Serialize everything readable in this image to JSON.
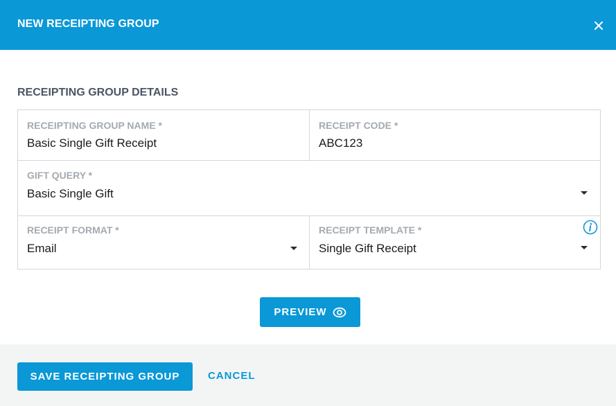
{
  "dialog": {
    "title": "NEW RECEIPTING GROUP",
    "close_icon": "close-icon"
  },
  "section": {
    "title": "RECEIPTING GROUP DETAILS"
  },
  "fields": {
    "group_name": {
      "label": "RECEIPTING GROUP NAME *",
      "value": "Basic Single Gift Receipt"
    },
    "receipt_code": {
      "label": "RECEIPT CODE *",
      "value": "ABC123"
    },
    "gift_query": {
      "label": "GIFT QUERY *",
      "value": "Basic Single Gift"
    },
    "receipt_format": {
      "label": "RECEIPT FORMAT *",
      "value": "Email"
    },
    "receipt_template": {
      "label": "RECEIPT TEMPLATE *",
      "value": "Single Gift Receipt",
      "info_icon": "info-icon"
    }
  },
  "actions": {
    "preview_label": "PREVIEW",
    "preview_icon": "eye-icon",
    "save_label": "SAVE RECEIPTING GROUP",
    "cancel_label": "CANCEL"
  },
  "colors": {
    "accent": "#0a98d6",
    "footer_bg": "#f3f5f5",
    "label_gray": "#a4aab1",
    "border": "#d3d6da"
  }
}
